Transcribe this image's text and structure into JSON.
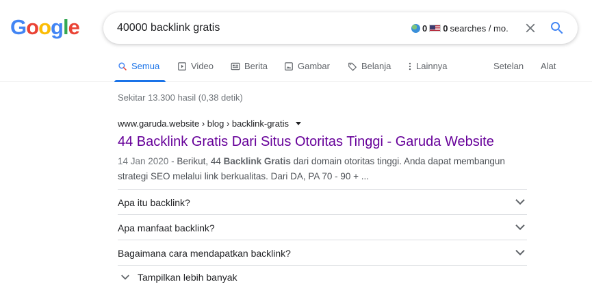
{
  "logo": {
    "letters": [
      "G",
      "o",
      "o",
      "g",
      "l",
      "e"
    ]
  },
  "colors": {
    "blue": "#4285f4",
    "red": "#ea4335",
    "yellow": "#fbbc05",
    "green": "#34a853",
    "link_visited": "#660099",
    "accent": "#1a73e8"
  },
  "search": {
    "query": "40000 backlink gratis"
  },
  "keyword_widget": {
    "left_count": "0",
    "right_count": "0",
    "suffix": "searches / mo."
  },
  "tabs": [
    {
      "label": "Semua",
      "icon": "search-icon"
    },
    {
      "label": "Video",
      "icon": "video-icon"
    },
    {
      "label": "Berita",
      "icon": "news-icon"
    },
    {
      "label": "Gambar",
      "icon": "image-icon"
    },
    {
      "label": "Belanja",
      "icon": "tag-icon"
    },
    {
      "label": "Lainnya",
      "icon": "more-vert-icon"
    }
  ],
  "tools": {
    "settings": "Setelan",
    "tools": "Alat"
  },
  "stats": "Sekitar 13.300 hasil (0,38 detik)",
  "result": {
    "url": "www.garuda.website › blog › backlink-gratis",
    "title": "44 Backlink Gratis Dari Situs Otoritas Tinggi - Garuda Website",
    "date": "14 Jan 2020",
    "snippet_pre": " - Berikut, 44 ",
    "snippet_bold": "Backlink Gratis",
    "snippet_post": " dari domain otoritas tinggi. Anda dapat membangun strategi SEO melalui link berkualitas. Dari DA, PA 70 - 90 + ..."
  },
  "faqs": [
    "Apa itu backlink?",
    "Apa manfaat backlink?",
    "Bagaimana cara mendapatkan backlink?"
  ],
  "show_more": "Tampilkan lebih banyak"
}
